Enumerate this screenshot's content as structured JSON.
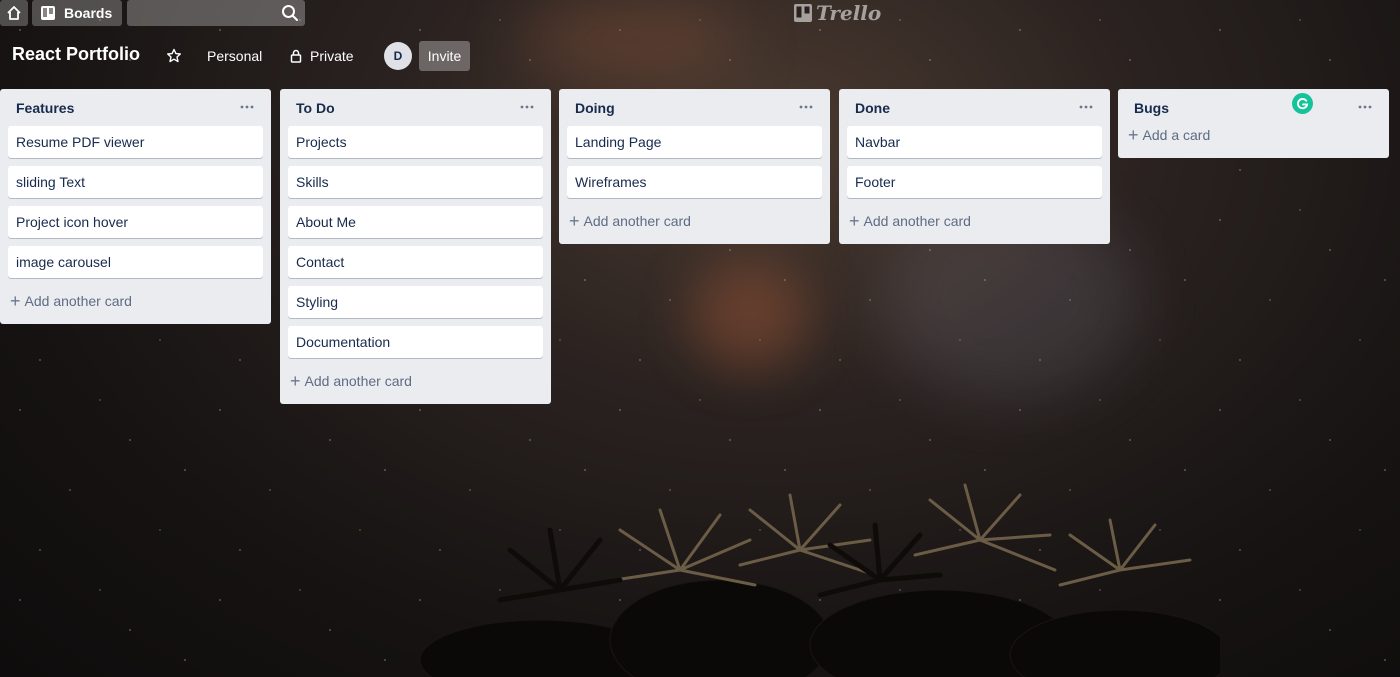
{
  "header": {
    "boards_label": "Boards",
    "search_placeholder": "",
    "logo_text": "Trello"
  },
  "board": {
    "title": "React Portfolio",
    "personal_label": "Personal",
    "private_label": "Private",
    "avatar_initial": "D",
    "invite_label": "Invite"
  },
  "lists": [
    {
      "title": "Features",
      "cards": [
        "Resume PDF viewer",
        "sliding Text",
        "Project icon hover",
        "image carousel"
      ],
      "add_label": "Add another card"
    },
    {
      "title": "To Do",
      "cards": [
        "Projects",
        "Skills",
        "About Me",
        "Contact",
        "Styling",
        "Documentation"
      ],
      "add_label": "Add another card"
    },
    {
      "title": "Doing",
      "cards": [
        "Landing Page",
        "Wireframes"
      ],
      "add_label": "Add another card"
    },
    {
      "title": "Done",
      "cards": [
        "Navbar",
        "Footer"
      ],
      "add_label": "Add another card"
    },
    {
      "title": "Bugs",
      "cards": [],
      "add_label": "Add a card"
    }
  ],
  "icons": {
    "home": "home-icon",
    "boards": "boards-icon",
    "search": "search-icon",
    "star": "star-icon",
    "lock": "lock-icon",
    "menu": "more-icon",
    "grammarly": "grammarly-icon"
  },
  "colors": {
    "list_bg": "#ebecf0",
    "card_bg": "#ffffff",
    "text": "#172b4d",
    "muted": "#5e6c84",
    "grammarly": "#15c39a"
  }
}
